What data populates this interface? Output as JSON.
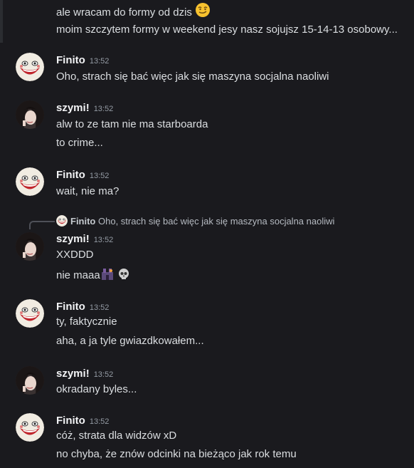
{
  "messages": [
    {
      "lines": [
        "ale wracam do formy od dzis",
        "moim szczytem formy w weekend jesy nasz sojujsz 15-14-13 osobowy..."
      ]
    },
    {
      "author": "Finito",
      "time": "13:52",
      "lines": [
        "Oho, strach się bać więc jak się maszyna socjalna naoliwi"
      ]
    },
    {
      "author": "szymi!",
      "time": "13:52",
      "lines": [
        "alw to ze tam nie ma starboarda",
        "to crime..."
      ]
    },
    {
      "author": "Finito",
      "time": "13:52",
      "lines": [
        "wait, nie ma?"
      ]
    },
    {
      "reply": {
        "author": "Finito",
        "text": "Oho, strach się bać więc jak się maszyna socjalna naoliwi"
      },
      "author": "szymi!",
      "time": "13:52",
      "lines": [
        "XXDDD",
        "nie maaa"
      ]
    },
    {
      "author": "Finito",
      "time": "13:52",
      "lines": [
        "ty, faktycznie",
        "aha, a ja tyle gwiazdkowałem..."
      ]
    },
    {
      "author": "szymi!",
      "time": "13:52",
      "lines": [
        "okradany byles..."
      ]
    },
    {
      "author": "Finito",
      "time": "13:52",
      "lines": [
        "cóż, strata dla widzów xD",
        "no chyba, że znów odcinki na bieżąco jak rok temu"
      ]
    }
  ],
  "icons": {
    "flex": "smirk-emoji",
    "castle": "castle-emoji",
    "skull": "skull-emoji"
  }
}
